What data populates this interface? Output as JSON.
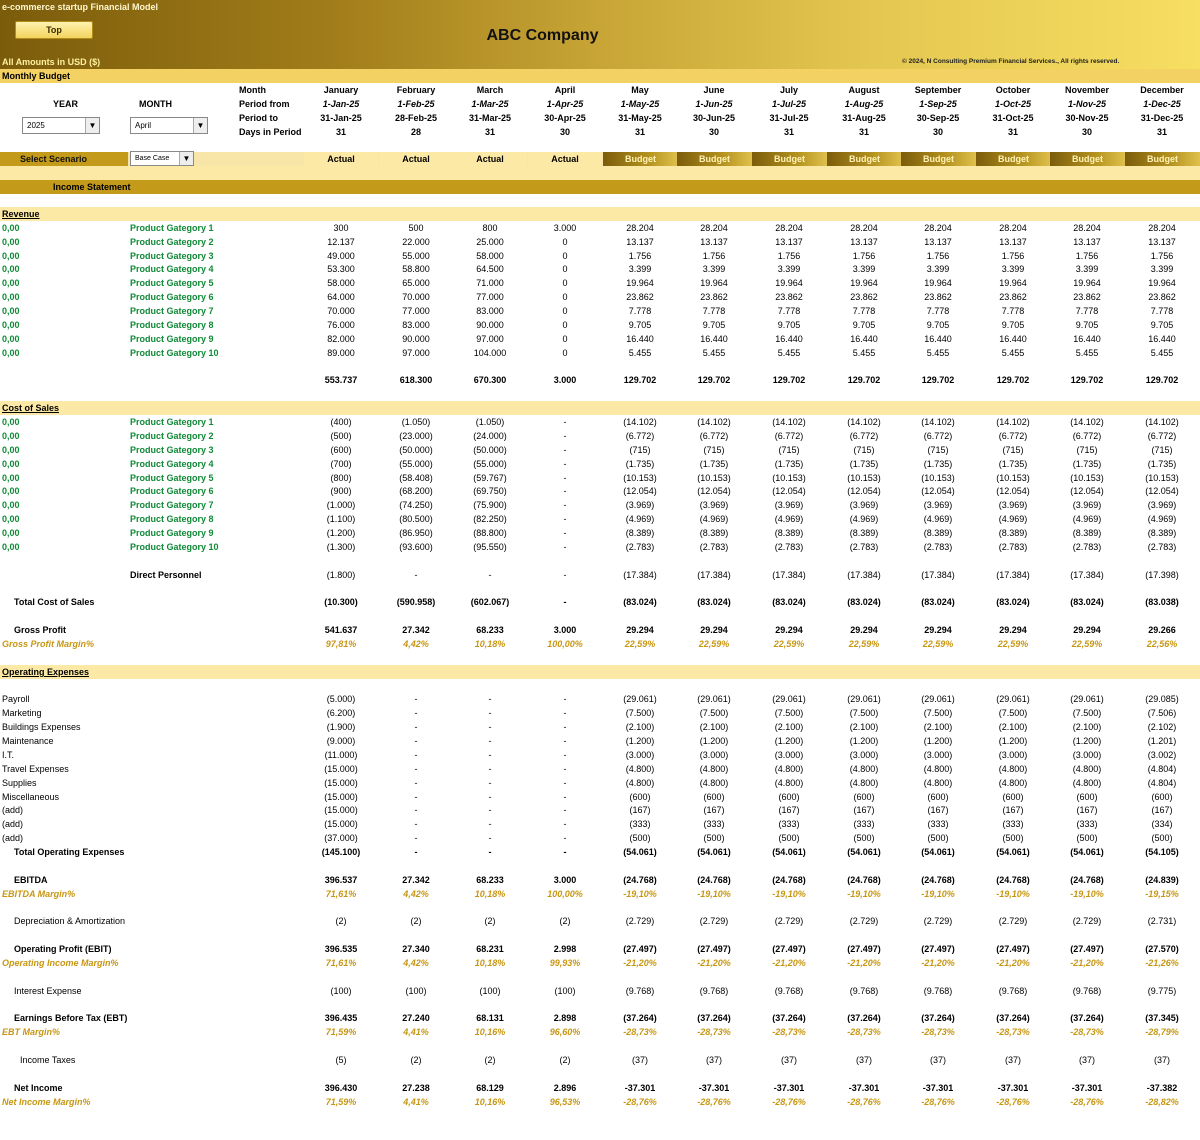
{
  "header": {
    "app_title": "e-commerce startup Financial  Model",
    "top_button": "Top",
    "company": "ABC Company",
    "amounts": "All Amounts in  USD ($)",
    "copyright": "© 2024, N Consulting Premium Financial Services., All rights reserved."
  },
  "section_title": "Monthly Budget",
  "controls": {
    "year_label": "YEAR",
    "month_label": "MONTH",
    "year_value": "2025",
    "month_value": "April",
    "scenario_label": "Select Scenario",
    "scenario_value": "Base Case"
  },
  "period_labels": [
    "Month",
    "Period from",
    "Period to",
    "Days in Period"
  ],
  "months": [
    {
      "name": "January",
      "from": "1-Jan-25",
      "to": "31-Jan-25",
      "days": "31",
      "scenario": "Actual"
    },
    {
      "name": "February",
      "from": "1-Feb-25",
      "to": "28-Feb-25",
      "days": "28",
      "scenario": "Actual"
    },
    {
      "name": "March",
      "from": "1-Mar-25",
      "to": "31-Mar-25",
      "days": "31",
      "scenario": "Actual"
    },
    {
      "name": "April",
      "from": "1-Apr-25",
      "to": "30-Apr-25",
      "days": "30",
      "scenario": "Actual"
    },
    {
      "name": "May",
      "from": "1-May-25",
      "to": "31-May-25",
      "days": "31",
      "scenario": "Budget"
    },
    {
      "name": "June",
      "from": "1-Jun-25",
      "to": "30-Jun-25",
      "days": "30",
      "scenario": "Budget"
    },
    {
      "name": "July",
      "from": "1-Jul-25",
      "to": "31-Jul-25",
      "days": "31",
      "scenario": "Budget"
    },
    {
      "name": "August",
      "from": "1-Aug-25",
      "to": "31-Aug-25",
      "days": "31",
      "scenario": "Budget"
    },
    {
      "name": "September",
      "from": "1-Sep-25",
      "to": "30-Sep-25",
      "days": "30",
      "scenario": "Budget"
    },
    {
      "name": "October",
      "from": "1-Oct-25",
      "to": "31-Oct-25",
      "days": "31",
      "scenario": "Budget"
    },
    {
      "name": "November",
      "from": "1-Nov-25",
      "to": "30-Nov-25",
      "days": "30",
      "scenario": "Budget"
    },
    {
      "name": "December",
      "from": "1-Dec-25",
      "to": "31-Dec-25",
      "days": "31",
      "scenario": "Budget"
    }
  ],
  "income_statement_title": "Income Statement",
  "rows": [
    {
      "kind": "section",
      "label": "Revenue"
    },
    {
      "kind": "gcat",
      "prefix": "0,00",
      "label": "Product Gategory 1",
      "values": [
        "300",
        "500",
        "800",
        "3.000",
        "28.204",
        "28.204",
        "28.204",
        "28.204",
        "28.204",
        "28.204",
        "28.204",
        "28.204"
      ]
    },
    {
      "kind": "gcat",
      "prefix": "0,00",
      "label": "Product Gategory 2",
      "values": [
        "12.137",
        "22.000",
        "25.000",
        "0",
        "13.137",
        "13.137",
        "13.137",
        "13.137",
        "13.137",
        "13.137",
        "13.137",
        "13.137"
      ]
    },
    {
      "kind": "gcat",
      "prefix": "0,00",
      "label": "Product Gategory 3",
      "values": [
        "49.000",
        "55.000",
        "58.000",
        "0",
        "1.756",
        "1.756",
        "1.756",
        "1.756",
        "1.756",
        "1.756",
        "1.756",
        "1.756"
      ]
    },
    {
      "kind": "gcat",
      "prefix": "0,00",
      "label": "Product Gategory 4",
      "values": [
        "53.300",
        "58.800",
        "64.500",
        "0",
        "3.399",
        "3.399",
        "3.399",
        "3.399",
        "3.399",
        "3.399",
        "3.399",
        "3.399"
      ]
    },
    {
      "kind": "gcat",
      "prefix": "0,00",
      "label": "Product Gategory 5",
      "values": [
        "58.000",
        "65.000",
        "71.000",
        "0",
        "19.964",
        "19.964",
        "19.964",
        "19.964",
        "19.964",
        "19.964",
        "19.964",
        "19.964"
      ]
    },
    {
      "kind": "gcat",
      "prefix": "0,00",
      "label": "Product Gategory 6",
      "values": [
        "64.000",
        "70.000",
        "77.000",
        "0",
        "23.862",
        "23.862",
        "23.862",
        "23.862",
        "23.862",
        "23.862",
        "23.862",
        "23.862"
      ]
    },
    {
      "kind": "gcat",
      "prefix": "0,00",
      "label": "Product Gategory 7",
      "values": [
        "70.000",
        "77.000",
        "83.000",
        "0",
        "7.778",
        "7.778",
        "7.778",
        "7.778",
        "7.778",
        "7.778",
        "7.778",
        "7.778"
      ]
    },
    {
      "kind": "gcat",
      "prefix": "0,00",
      "label": "Product Gategory 8",
      "values": [
        "76.000",
        "83.000",
        "90.000",
        "0",
        "9.705",
        "9.705",
        "9.705",
        "9.705",
        "9.705",
        "9.705",
        "9.705",
        "9.705"
      ]
    },
    {
      "kind": "gcat",
      "prefix": "0,00",
      "label": "Product Gategory 9",
      "values": [
        "82.000",
        "90.000",
        "97.000",
        "0",
        "16.440",
        "16.440",
        "16.440",
        "16.440",
        "16.440",
        "16.440",
        "16.440",
        "16.440"
      ]
    },
    {
      "kind": "gcat",
      "prefix": "0,00",
      "label": "Product Gategory 10",
      "values": [
        "89.000",
        "97.000",
        "104.000",
        "0",
        "5.455",
        "5.455",
        "5.455",
        "5.455",
        "5.455",
        "5.455",
        "5.455",
        "5.455"
      ]
    },
    {
      "kind": "blank"
    },
    {
      "kind": "total",
      "label": "",
      "values": [
        "553.737",
        "618.300",
        "670.300",
        "3.000",
        "129.702",
        "129.702",
        "129.702",
        "129.702",
        "129.702",
        "129.702",
        "129.702",
        "129.702"
      ]
    },
    {
      "kind": "blank"
    },
    {
      "kind": "section",
      "label": "Cost of Sales"
    },
    {
      "kind": "gcat",
      "prefix": "0,00",
      "label": "Product Gategory 1",
      "values": [
        "(400)",
        "(1.050)",
        "(1.050)",
        "-",
        "(14.102)",
        "(14.102)",
        "(14.102)",
        "(14.102)",
        "(14.102)",
        "(14.102)",
        "(14.102)",
        "(14.102)"
      ]
    },
    {
      "kind": "gcat",
      "prefix": "0,00",
      "label": "Product Gategory 2",
      "values": [
        "(500)",
        "(23.000)",
        "(24.000)",
        "-",
        "(6.772)",
        "(6.772)",
        "(6.772)",
        "(6.772)",
        "(6.772)",
        "(6.772)",
        "(6.772)",
        "(6.772)"
      ]
    },
    {
      "kind": "gcat",
      "prefix": "0,00",
      "label": "Product Gategory 3",
      "values": [
        "(600)",
        "(50.000)",
        "(50.000)",
        "-",
        "(715)",
        "(715)",
        "(715)",
        "(715)",
        "(715)",
        "(715)",
        "(715)",
        "(715)"
      ]
    },
    {
      "kind": "gcat",
      "prefix": "0,00",
      "label": "Product Gategory 4",
      "values": [
        "(700)",
        "(55.000)",
        "(55.000)",
        "-",
        "(1.735)",
        "(1.735)",
        "(1.735)",
        "(1.735)",
        "(1.735)",
        "(1.735)",
        "(1.735)",
        "(1.735)"
      ]
    },
    {
      "kind": "gcat",
      "prefix": "0,00",
      "label": "Product Gategory 5",
      "values": [
        "(800)",
        "(58.408)",
        "(59.767)",
        "-",
        "(10.153)",
        "(10.153)",
        "(10.153)",
        "(10.153)",
        "(10.153)",
        "(10.153)",
        "(10.153)",
        "(10.153)"
      ]
    },
    {
      "kind": "gcat",
      "prefix": "0,00",
      "label": "Product Gategory 6",
      "values": [
        "(900)",
        "(68.200)",
        "(69.750)",
        "-",
        "(12.054)",
        "(12.054)",
        "(12.054)",
        "(12.054)",
        "(12.054)",
        "(12.054)",
        "(12.054)",
        "(12.054)"
      ]
    },
    {
      "kind": "gcat",
      "prefix": "0,00",
      "label": "Product Gategory 7",
      "values": [
        "(1.000)",
        "(74.250)",
        "(75.900)",
        "-",
        "(3.969)",
        "(3.969)",
        "(3.969)",
        "(3.969)",
        "(3.969)",
        "(3.969)",
        "(3.969)",
        "(3.969)"
      ]
    },
    {
      "kind": "gcat",
      "prefix": "0,00",
      "label": "Product Gategory 8",
      "values": [
        "(1.100)",
        "(80.500)",
        "(82.250)",
        "-",
        "(4.969)",
        "(4.969)",
        "(4.969)",
        "(4.969)",
        "(4.969)",
        "(4.969)",
        "(4.969)",
        "(4.969)"
      ]
    },
    {
      "kind": "gcat",
      "prefix": "0,00",
      "label": "Product Gategory 9",
      "values": [
        "(1.200)",
        "(86.950)",
        "(88.800)",
        "-",
        "(8.389)",
        "(8.389)",
        "(8.389)",
        "(8.389)",
        "(8.389)",
        "(8.389)",
        "(8.389)",
        "(8.389)"
      ]
    },
    {
      "kind": "gcat",
      "prefix": "0,00",
      "label": "Product Gategory 10",
      "values": [
        "(1.300)",
        "(93.600)",
        "(95.550)",
        "-",
        "(2.783)",
        "(2.783)",
        "(2.783)",
        "(2.783)",
        "(2.783)",
        "(2.783)",
        "(2.783)",
        "(2.783)"
      ]
    },
    {
      "kind": "blank"
    },
    {
      "kind": "catlabel",
      "label": "Direct Personnel",
      "values": [
        "(1.800)",
        "-",
        "-",
        "-",
        "(17.384)",
        "(17.384)",
        "(17.384)",
        "(17.384)",
        "(17.384)",
        "(17.384)",
        "(17.384)",
        "(17.398)"
      ]
    },
    {
      "kind": "blank"
    },
    {
      "kind": "boldind",
      "label": "Total Cost of Sales",
      "values": [
        "(10.300)",
        "(590.958)",
        "(602.067)",
        "-",
        "(83.024)",
        "(83.024)",
        "(83.024)",
        "(83.024)",
        "(83.024)",
        "(83.024)",
        "(83.024)",
        "(83.038)"
      ]
    },
    {
      "kind": "blank"
    },
    {
      "kind": "boldind",
      "label": "Gross Profit",
      "values": [
        "541.637",
        "27.342",
        "68.233",
        "3.000",
        "29.294",
        "29.294",
        "29.294",
        "29.294",
        "29.294",
        "29.294",
        "29.294",
        "29.266"
      ]
    },
    {
      "kind": "margin",
      "label": "Gross Profit Margin%",
      "values": [
        "97,81%",
        "4,42%",
        "10,18%",
        "100,00%",
        "22,59%",
        "22,59%",
        "22,59%",
        "22,59%",
        "22,59%",
        "22,59%",
        "22,59%",
        "22,56%"
      ]
    },
    {
      "kind": "blank"
    },
    {
      "kind": "section",
      "label": "Operating Expenses"
    },
    {
      "kind": "blank"
    },
    {
      "kind": "plain",
      "label": "Payroll",
      "values": [
        "(5.000)",
        "-",
        "-",
        "-",
        "(29.061)",
        "(29.061)",
        "(29.061)",
        "(29.061)",
        "(29.061)",
        "(29.061)",
        "(29.061)",
        "(29.085)"
      ]
    },
    {
      "kind": "plain",
      "label": "Marketing",
      "values": [
        "(6.200)",
        "-",
        "-",
        "-",
        "(7.500)",
        "(7.500)",
        "(7.500)",
        "(7.500)",
        "(7.500)",
        "(7.500)",
        "(7.500)",
        "(7.506)"
      ]
    },
    {
      "kind": "plain",
      "label": "Buildings Expenses",
      "values": [
        "(1.900)",
        "-",
        "-",
        "-",
        "(2.100)",
        "(2.100)",
        "(2.100)",
        "(2.100)",
        "(2.100)",
        "(2.100)",
        "(2.100)",
        "(2.102)"
      ]
    },
    {
      "kind": "plain",
      "label": "Maintenance",
      "values": [
        "(9.000)",
        "-",
        "-",
        "-",
        "(1.200)",
        "(1.200)",
        "(1.200)",
        "(1.200)",
        "(1.200)",
        "(1.200)",
        "(1.200)",
        "(1.201)"
      ]
    },
    {
      "kind": "plain",
      "label": "I.T.",
      "values": [
        "(11.000)",
        "-",
        "-",
        "-",
        "(3.000)",
        "(3.000)",
        "(3.000)",
        "(3.000)",
        "(3.000)",
        "(3.000)",
        "(3.000)",
        "(3.002)"
      ]
    },
    {
      "kind": "plain",
      "label": "Travel Expenses",
      "values": [
        "(15.000)",
        "-",
        "-",
        "-",
        "(4.800)",
        "(4.800)",
        "(4.800)",
        "(4.800)",
        "(4.800)",
        "(4.800)",
        "(4.800)",
        "(4.804)"
      ]
    },
    {
      "kind": "plain",
      "label": "Supplies",
      "values": [
        "(15.000)",
        "-",
        "-",
        "-",
        "(4.800)",
        "(4.800)",
        "(4.800)",
        "(4.800)",
        "(4.800)",
        "(4.800)",
        "(4.800)",
        "(4.804)"
      ]
    },
    {
      "kind": "plain",
      "label": "Miscellaneous",
      "values": [
        "(15.000)",
        "-",
        "-",
        "-",
        "(600)",
        "(600)",
        "(600)",
        "(600)",
        "(600)",
        "(600)",
        "(600)",
        "(600)"
      ]
    },
    {
      "kind": "plain",
      "label": "(add)",
      "values": [
        "(15.000)",
        "-",
        "-",
        "-",
        "(167)",
        "(167)",
        "(167)",
        "(167)",
        "(167)",
        "(167)",
        "(167)",
        "(167)"
      ]
    },
    {
      "kind": "plain",
      "label": "(add)",
      "values": [
        "(15.000)",
        "-",
        "-",
        "-",
        "(333)",
        "(333)",
        "(333)",
        "(333)",
        "(333)",
        "(333)",
        "(333)",
        "(334)"
      ]
    },
    {
      "kind": "plain",
      "label": "(add)",
      "values": [
        "(37.000)",
        "-",
        "-",
        "-",
        "(500)",
        "(500)",
        "(500)",
        "(500)",
        "(500)",
        "(500)",
        "(500)",
        "(500)"
      ]
    },
    {
      "kind": "boldind",
      "label": "Total Operating Expenses",
      "values": [
        "(145.100)",
        "-",
        "-",
        "-",
        "(54.061)",
        "(54.061)",
        "(54.061)",
        "(54.061)",
        "(54.061)",
        "(54.061)",
        "(54.061)",
        "(54.105)"
      ]
    },
    {
      "kind": "blank"
    },
    {
      "kind": "boldind",
      "label": "EBITDA",
      "values": [
        "396.537",
        "27.342",
        "68.233",
        "3.000",
        "(24.768)",
        "(24.768)",
        "(24.768)",
        "(24.768)",
        "(24.768)",
        "(24.768)",
        "(24.768)",
        "(24.839)"
      ]
    },
    {
      "kind": "margin",
      "label": "EBITDA Margin%",
      "values": [
        "71,61%",
        "4,42%",
        "10,18%",
        "100,00%",
        "-19,10%",
        "-19,10%",
        "-19,10%",
        "-19,10%",
        "-19,10%",
        "-19,10%",
        "-19,10%",
        "-19,15%"
      ]
    },
    {
      "kind": "blank"
    },
    {
      "kind": "ind",
      "label": "Depreciation & Amortization",
      "values": [
        "(2)",
        "(2)",
        "(2)",
        "(2)",
        "(2.729)",
        "(2.729)",
        "(2.729)",
        "(2.729)",
        "(2.729)",
        "(2.729)",
        "(2.729)",
        "(2.731)"
      ]
    },
    {
      "kind": "blank"
    },
    {
      "kind": "boldind",
      "label": "Operating Profit (EBIT)",
      "values": [
        "396.535",
        "27.340",
        "68.231",
        "2.998",
        "(27.497)",
        "(27.497)",
        "(27.497)",
        "(27.497)",
        "(27.497)",
        "(27.497)",
        "(27.497)",
        "(27.570)"
      ]
    },
    {
      "kind": "margin",
      "label": "Operating Income Margin%",
      "values": [
        "71,61%",
        "4,42%",
        "10,18%",
        "99,93%",
        "-21,20%",
        "-21,20%",
        "-21,20%",
        "-21,20%",
        "-21,20%",
        "-21,20%",
        "-21,20%",
        "-21,26%"
      ]
    },
    {
      "kind": "blank"
    },
    {
      "kind": "ind",
      "label": "Interest Expense",
      "values": [
        "(100)",
        "(100)",
        "(100)",
        "(100)",
        "(9.768)",
        "(9.768)",
        "(9.768)",
        "(9.768)",
        "(9.768)",
        "(9.768)",
        "(9.768)",
        "(9.775)"
      ]
    },
    {
      "kind": "blank"
    },
    {
      "kind": "boldind",
      "label": "Earnings Before Tax (EBT)",
      "values": [
        "396.435",
        "27.240",
        "68.131",
        "2.898",
        "(37.264)",
        "(37.264)",
        "(37.264)",
        "(37.264)",
        "(37.264)",
        "(37.264)",
        "(37.264)",
        "(37.345)"
      ]
    },
    {
      "kind": "margin",
      "label": "EBT Margin%",
      "values": [
        "71,59%",
        "4,41%",
        "10,16%",
        "96,60%",
        "-28,73%",
        "-28,73%",
        "-28,73%",
        "-28,73%",
        "-28,73%",
        "-28,73%",
        "-28,73%",
        "-28,79%"
      ]
    },
    {
      "kind": "blank"
    },
    {
      "kind": "ind2",
      "label": "Income Taxes",
      "values": [
        "(5)",
        "(2)",
        "(2)",
        "(2)",
        "(37)",
        "(37)",
        "(37)",
        "(37)",
        "(37)",
        "(37)",
        "(37)",
        "(37)"
      ]
    },
    {
      "kind": "blank"
    },
    {
      "kind": "boldind",
      "label": "Net Income",
      "values": [
        "396.430",
        "27.238",
        "68.129",
        "2.896",
        "-37.301",
        "-37.301",
        "-37.301",
        "-37.301",
        "-37.301",
        "-37.301",
        "-37.301",
        "-37.382"
      ]
    },
    {
      "kind": "margin",
      "label": "Net Income Margin%",
      "values": [
        "71,59%",
        "4,41%",
        "10,16%",
        "96,53%",
        "-28,76%",
        "-28,76%",
        "-28,76%",
        "-28,76%",
        "-28,76%",
        "-28,76%",
        "-28,76%",
        "-28,82%"
      ]
    }
  ]
}
